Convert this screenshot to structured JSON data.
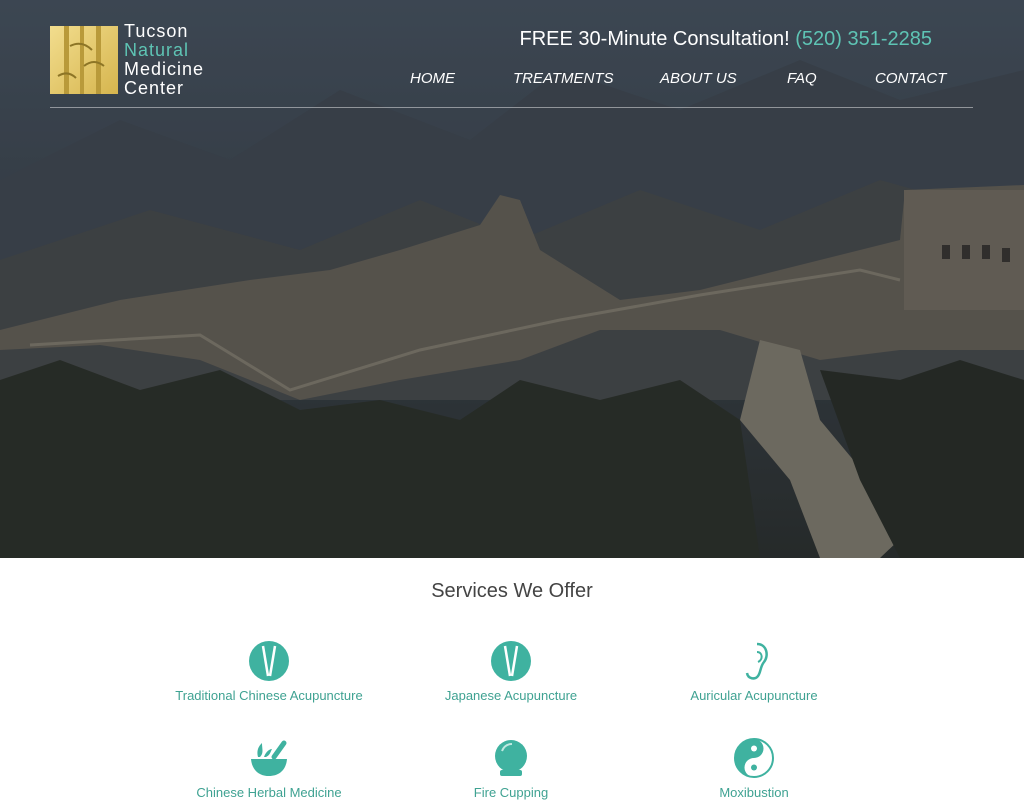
{
  "logo": {
    "line1": "Tucson",
    "line2": "Natural",
    "line3": "Medicine",
    "line4": "Center"
  },
  "header": {
    "consult_text": "FREE 30-Minute Consultation!",
    "phone": "(520) 351-2285"
  },
  "nav": {
    "items": [
      "HOME",
      "TREATMENTS",
      "ABOUT US",
      "FAQ",
      "CONTACT"
    ]
  },
  "services": {
    "title": "Services We Offer",
    "items": [
      {
        "label": "Traditional Chinese Acupuncture",
        "icon": "acupuncture-needles-icon"
      },
      {
        "label": "Japanese Acupuncture",
        "icon": "acupuncture-needles-icon"
      },
      {
        "label": "Auricular Acupuncture",
        "icon": "ear-icon"
      },
      {
        "label": "Chinese Herbal Medicine",
        "icon": "mortar-pestle-icon"
      },
      {
        "label": "Fire Cupping",
        "icon": "cupping-jar-icon"
      },
      {
        "label": "Moxibustion",
        "icon": "yin-yang-icon"
      }
    ]
  },
  "colors": {
    "accent": "#5ec4b4",
    "accent_text": "#3fa292",
    "hero_dark": "#3b4048"
  }
}
